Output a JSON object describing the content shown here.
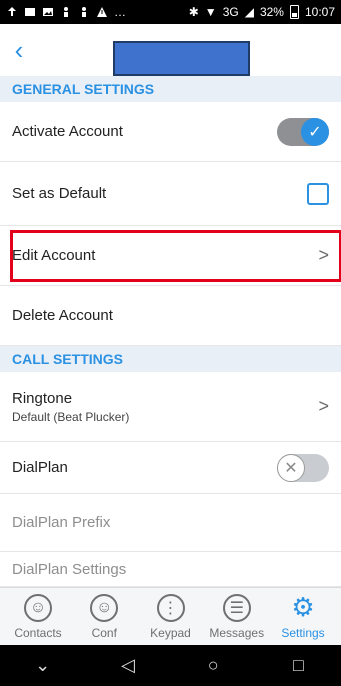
{
  "status_bar": {
    "network": "3G",
    "battery_percent": "32%",
    "time": "10:07"
  },
  "app_bar": {
    "back_icon": "chevron-left-icon"
  },
  "sections": {
    "general": {
      "title": "GENERAL SETTINGS",
      "activate_account": {
        "label": "Activate Account",
        "toggle_on": true
      },
      "set_default": {
        "label": "Set as Default",
        "checked": false
      },
      "edit_account": {
        "label": "Edit Account",
        "chevron": ">"
      },
      "delete_account": {
        "label": "Delete Account"
      }
    },
    "call": {
      "title": "CALL SETTINGS",
      "ringtone": {
        "label": "Ringtone",
        "value": "Default (Beat Plucker)",
        "chevron": ">"
      },
      "dialplan": {
        "label": "DialPlan",
        "toggle_on": false
      },
      "dialplan_prefix": {
        "label": "DialPlan Prefix"
      },
      "dialplan_settings": {
        "label": "DialPlan Settings"
      }
    }
  },
  "bottom_nav": [
    {
      "label": "Contacts",
      "icon": "contacts-icon",
      "active": false
    },
    {
      "label": "Conf",
      "icon": "conference-icon",
      "active": false
    },
    {
      "label": "Keypad",
      "icon": "keypad-icon",
      "active": false
    },
    {
      "label": "Messages",
      "icon": "messages-icon",
      "active": false
    },
    {
      "label": "Settings",
      "icon": "gear-icon",
      "active": true
    }
  ],
  "system_nav": {
    "icons": [
      "collapse-icon",
      "back-triangle-icon",
      "home-circle-icon",
      "recents-square-icon"
    ]
  },
  "colors": {
    "accent": "#2b91e3",
    "section_bg": "#e9eff6",
    "highlight": "#e2001a",
    "redacted": "#3f72cc"
  }
}
